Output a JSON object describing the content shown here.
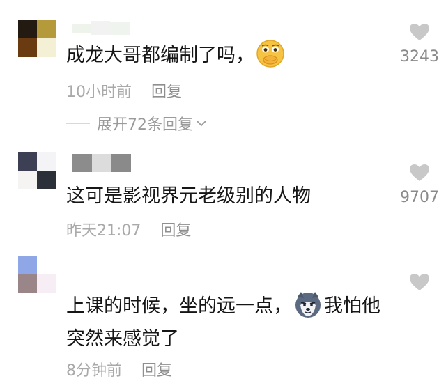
{
  "comments": [
    {
      "text": "成龙大哥都编制了吗，",
      "emoji": "covering-mouth-emoji",
      "time": "10小时前",
      "reply": "回复",
      "likes": "3243",
      "expand": "展开72条回复",
      "avatar_colors": [
        "#231a12",
        "#b59a3b",
        "#6a3b10",
        "#f4f0d6"
      ]
    },
    {
      "text": "这可是影视界元老级别的人物",
      "time": "昨天21:07",
      "reply": "回复",
      "likes": "9707",
      "avatar_colors": [
        "#3d3f54",
        "#f4f4f6",
        "#f6f4f3",
        "#2a2f38"
      ]
    },
    {
      "text_part1": "上课的时候，坐的远一点，",
      "emoji": "husky-dog-emoji",
      "text_part2": "我怕他",
      "text_line2": "突然来感觉了",
      "time": "8分钟前",
      "reply": "回复",
      "avatar_colors": [
        "#8fa7e6",
        "#ffffff",
        "#9a8688",
        "#f7eef5"
      ]
    }
  ],
  "colors": {
    "like_icon": "#c8c8c8",
    "meta": "#a9a9a9",
    "text": "#161616"
  }
}
